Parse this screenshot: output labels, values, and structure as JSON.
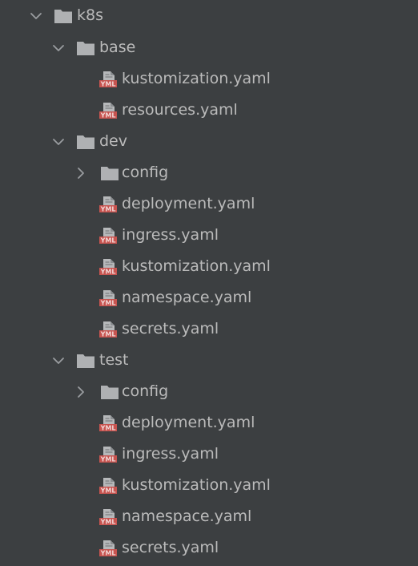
{
  "colors": {
    "background": "#3c3f41",
    "text": "#bbbbbb",
    "chevron": "#9a9da0",
    "folder": "#afb1b3",
    "yaml_badge": "#c75450",
    "yaml_page": "#b6b8ba"
  },
  "icons": {
    "expanded": "chevron-down-icon",
    "collapsed": "chevron-right-icon",
    "folder": "folder-icon",
    "yaml_file": "yaml-file-icon"
  },
  "yaml_badge_text": "YML",
  "tree": {
    "root": {
      "label": "k8s",
      "expanded": true
    },
    "base": {
      "label": "base",
      "expanded": true,
      "files": [
        "kustomization.yaml",
        "resources.yaml"
      ]
    },
    "dev": {
      "label": "dev",
      "expanded": true,
      "config": {
        "label": "config",
        "expanded": false
      },
      "files": [
        "deployment.yaml",
        "ingress.yaml",
        "kustomization.yaml",
        "namespace.yaml",
        "secrets.yaml"
      ]
    },
    "test": {
      "label": "test",
      "expanded": true,
      "config": {
        "label": "config",
        "expanded": false
      },
      "files": [
        "deployment.yaml",
        "ingress.yaml",
        "kustomization.yaml",
        "namespace.yaml",
        "secrets.yaml"
      ]
    }
  }
}
